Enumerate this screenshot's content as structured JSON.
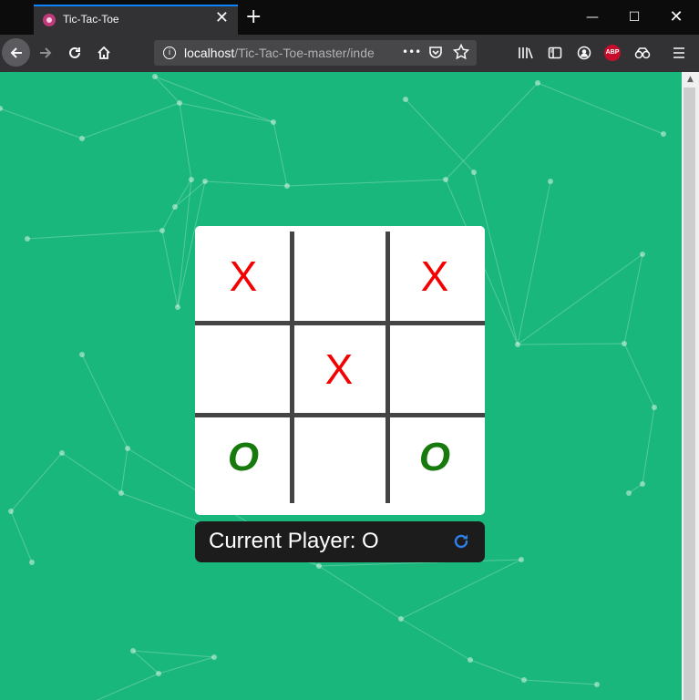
{
  "browser": {
    "tab_title": "Tic-Tac-Toe",
    "tab_close": "✕",
    "new_tab": "+",
    "url_host": "localhost",
    "url_path": "/Tic-Tac-Toe-master/inde",
    "more_dots": "•••",
    "abp_label": "ABP",
    "win_min": "—",
    "win_max": "☐",
    "win_close": "✕"
  },
  "game": {
    "board": [
      [
        "X",
        "",
        "X"
      ],
      [
        "",
        "X",
        ""
      ],
      [
        "O",
        "",
        "O"
      ]
    ],
    "status_text": "Current Player: O",
    "colors": {
      "background": "#1ab77c",
      "x_mark": "#f50000",
      "o_mark": "#177a0c",
      "status_bar": "#1c1c1c",
      "reset_icon": "#2f80ed"
    }
  }
}
